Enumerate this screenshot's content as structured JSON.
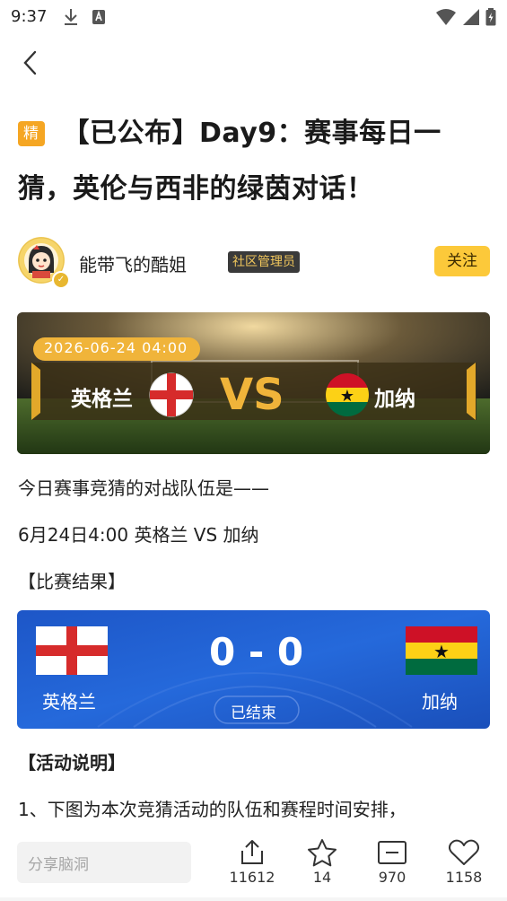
{
  "status_bar": {
    "time": "9:37"
  },
  "post": {
    "badge": "精",
    "title": "【已公布】Day9：赛事每日一猜，英伦与西非的绿茵对话！",
    "author": {
      "name": "能带飞的酷姐",
      "role_tag": "社区管理员"
    },
    "follow_label": "关注"
  },
  "banner": {
    "datetime": "2026-06-24 04:00",
    "team_home": "英格兰",
    "team_away": "加纳",
    "vs": "VS"
  },
  "body": {
    "intro": "今日赛事竞猜的对战队伍是——",
    "match_line": "6月24日4:00 英格兰 VS 加纳",
    "result_heading": "【比赛结果】",
    "activity_heading": "【活动说明】",
    "activity_line1": "1、下图为本次竞猜活动的队伍和赛程时间安排，"
  },
  "score_card": {
    "home": "英格兰",
    "away": "加纳",
    "score": "0 - 0",
    "status": "已结束"
  },
  "bottom_bar": {
    "comment_placeholder": "分享脑洞",
    "share_count": "11612",
    "star_count": "14",
    "comment_count": "970",
    "like_count": "1158"
  },
  "colors": {
    "accent_orange": "#f5a623",
    "follow_yellow": "#fcc93a",
    "score_blue": "#1f5fd1"
  }
}
